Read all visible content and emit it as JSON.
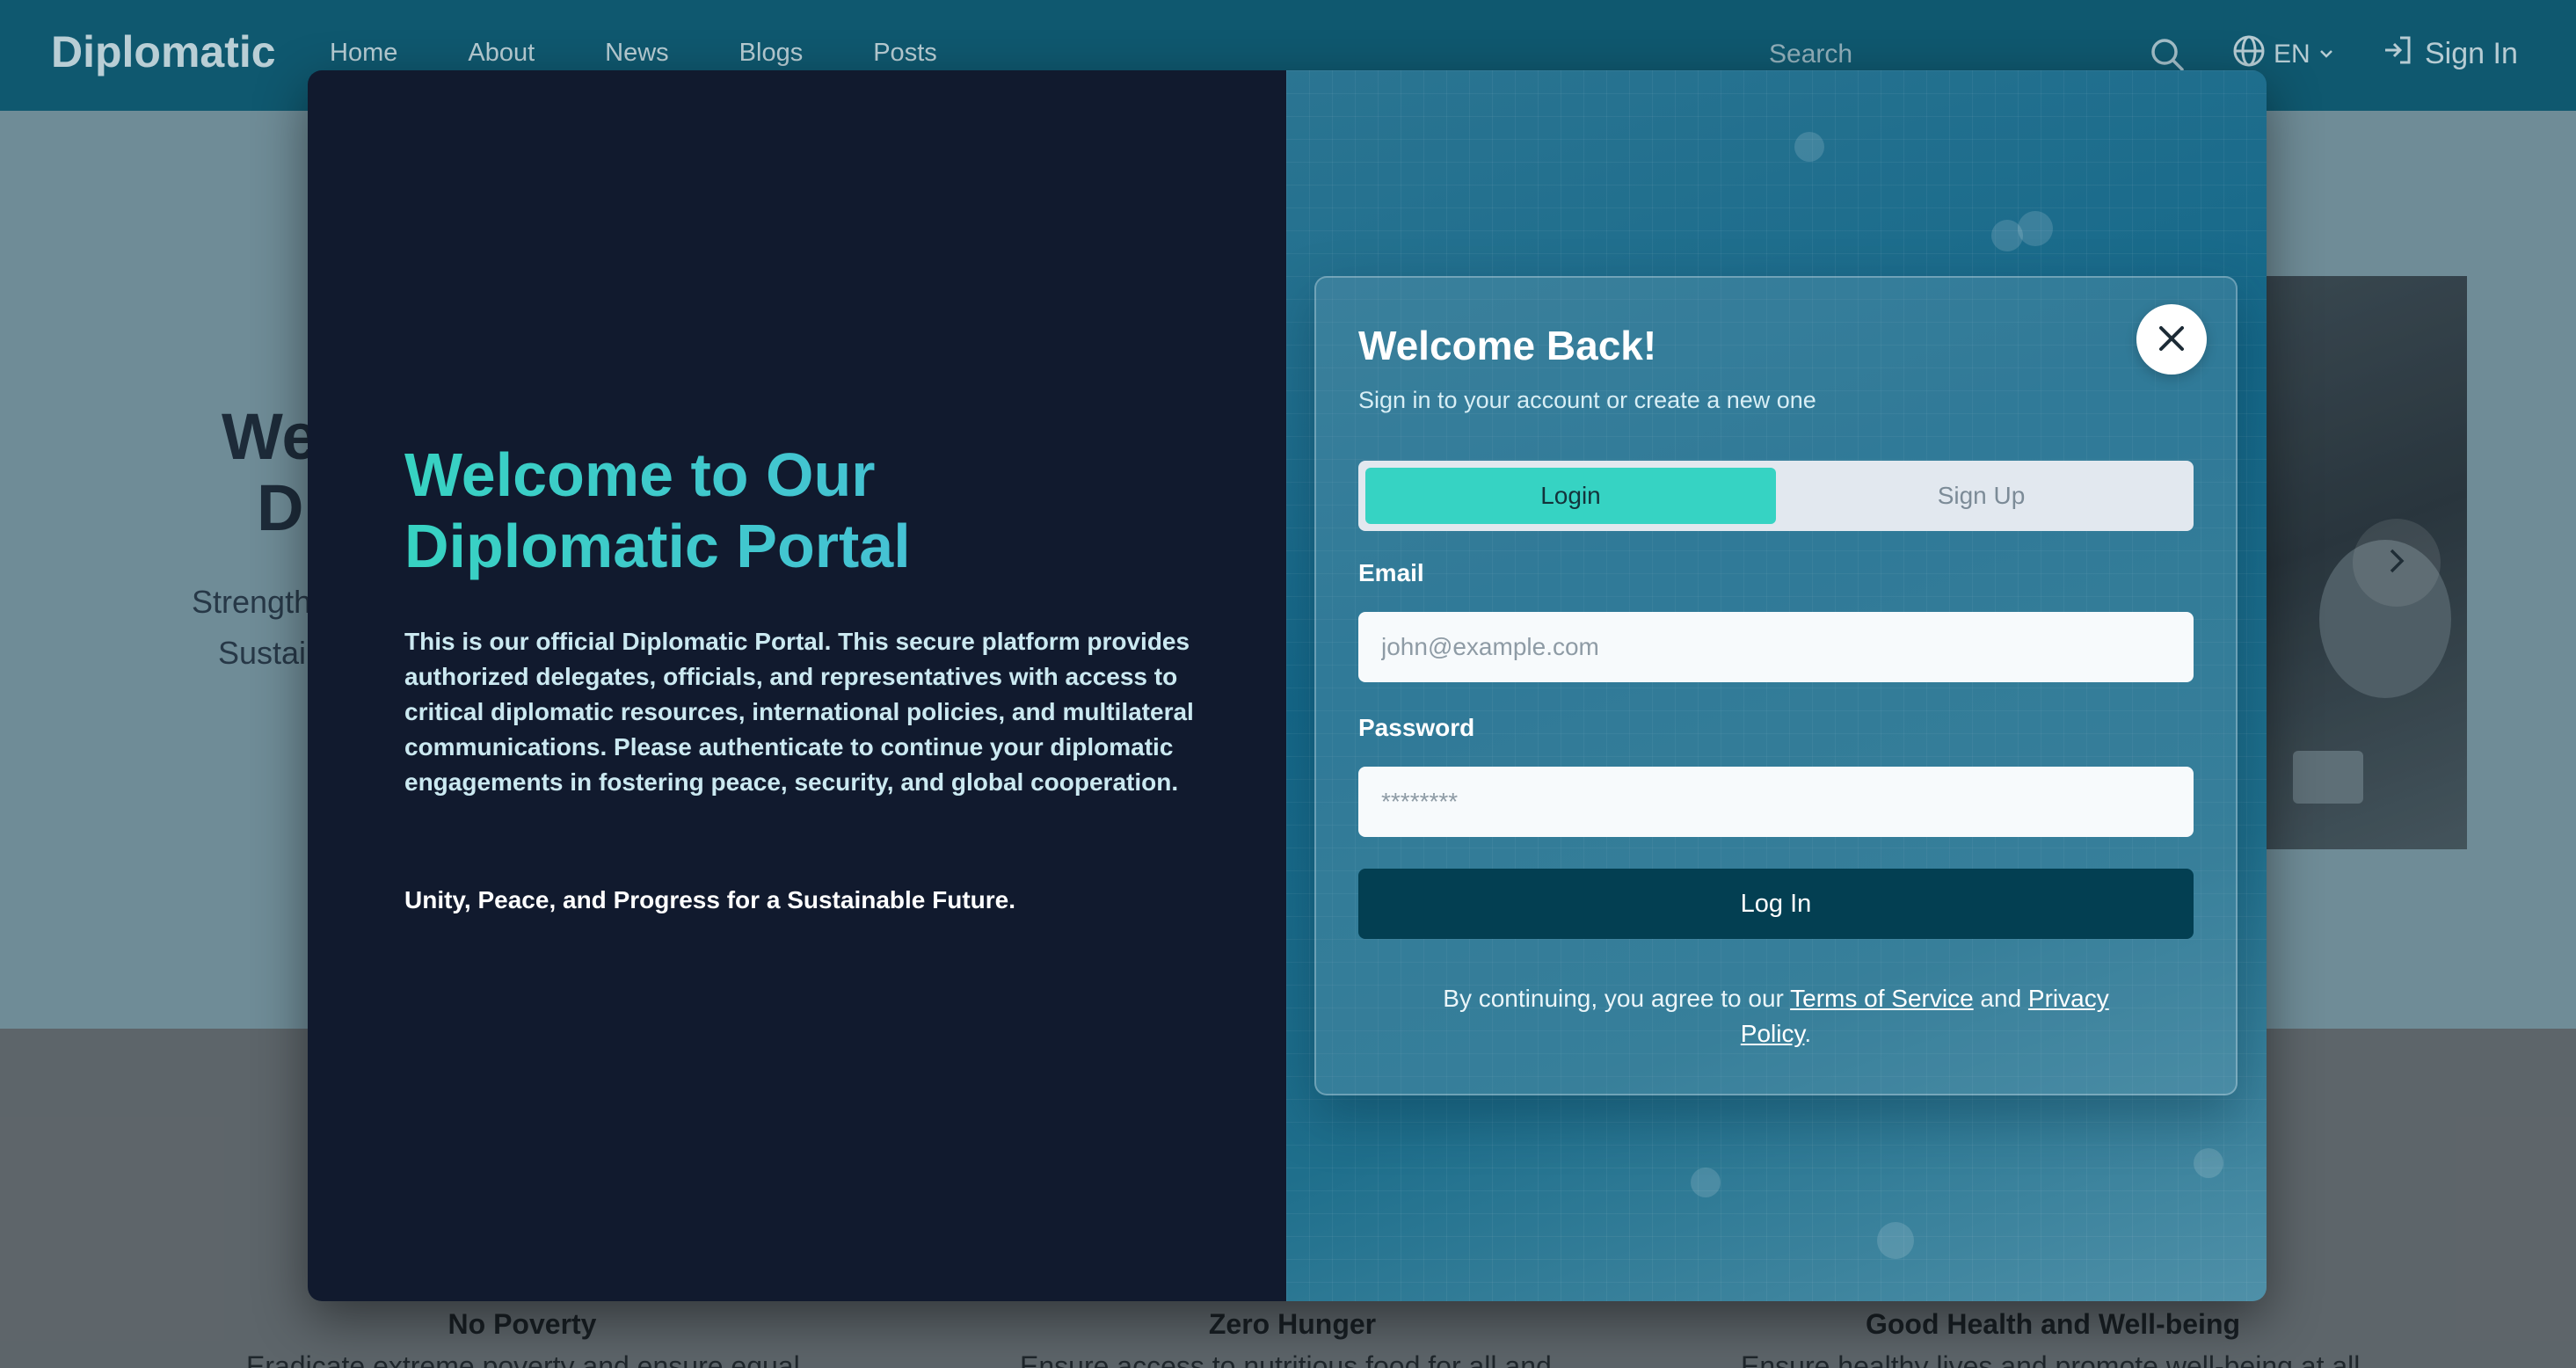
{
  "navbar": {
    "brand": "Diplomatic",
    "links": [
      "Home",
      "About",
      "News",
      "Blogs",
      "Posts"
    ],
    "search_placeholder": "Search",
    "language": "EN",
    "sign_in": "Sign In"
  },
  "hero": {
    "title_fragment_1": "We",
    "title_fragment_2": "D",
    "subtitle_fragment_1": "Strength",
    "subtitle_fragment_2": "Sustai"
  },
  "goals": [
    {
      "title": "No Poverty",
      "desc": "Eradicate extreme poverty and ensure equal"
    },
    {
      "title": "Zero Hunger",
      "desc": "Ensure access to nutritious food for all and"
    },
    {
      "title": "Good Health and Well-being",
      "desc": "Ensure healthy lives and promote well-being at all"
    }
  ],
  "modal": {
    "left": {
      "title_line1": "Welcome to Our",
      "title_line2": "Diplomatic Portal",
      "description": "This is our official Diplomatic Portal. This secure platform provides authorized delegates, officials, and representatives with access to critical diplomatic resources, international policies, and multilateral communications. Please authenticate to continue your diplomatic engagements in fostering peace, security, and global cooperation.",
      "motto": "Unity, Peace, and Progress for a Sustainable Future."
    },
    "card": {
      "title": "Welcome Back!",
      "subtitle": "Sign in to your account or create a new one",
      "tabs": {
        "login": "Login",
        "signup": "Sign Up"
      },
      "email_label": "Email",
      "email_placeholder": "john@example.com",
      "password_label": "Password",
      "password_placeholder": "********",
      "login_button": "Log In",
      "terms_prefix": "By continuing, you agree to our",
      "terms_link": "Terms of Service",
      "terms_and": "and",
      "privacy_link": "Privacy Policy",
      "terms_suffix": "."
    }
  },
  "colors": {
    "accent_teal": "#36d3c3",
    "navbar": "#0a5e78",
    "login_button": "#033f52",
    "modal_left_bg": "#111a2e"
  }
}
